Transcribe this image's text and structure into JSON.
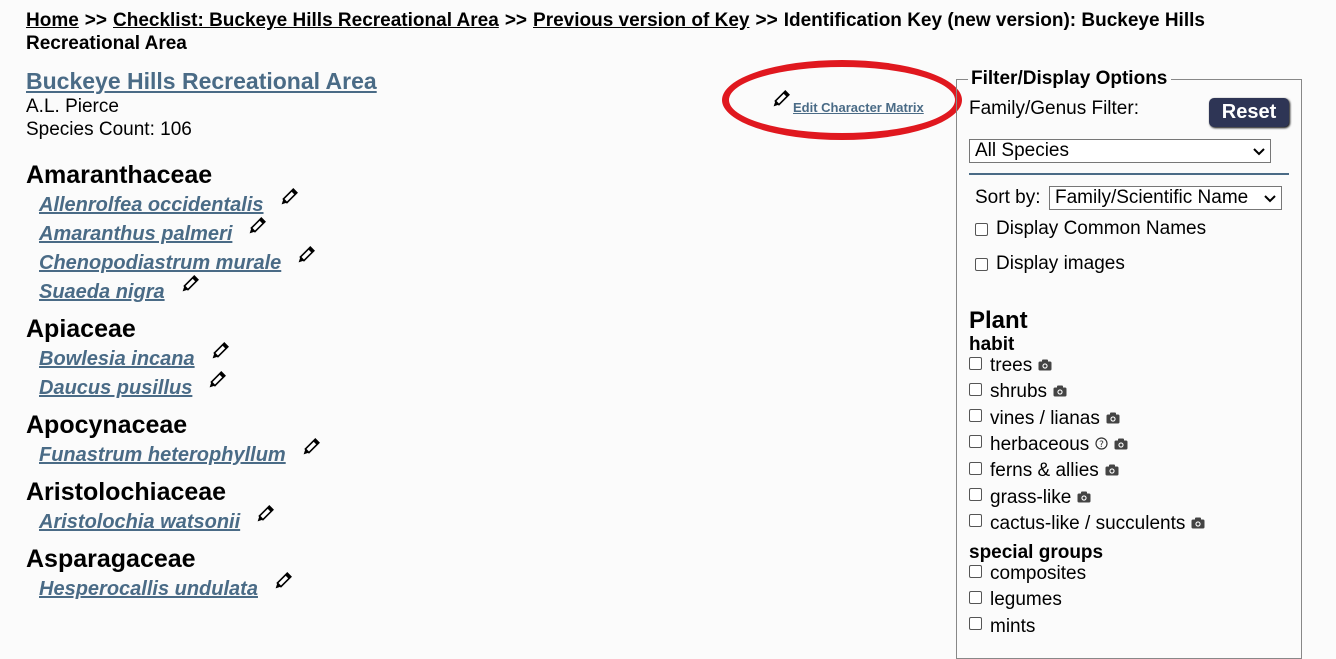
{
  "breadcrumb": {
    "home": "Home",
    "sep": ">>",
    "checklist": "Checklist: Buckeye Hills Recreational Area",
    "previous": "Previous version of Key",
    "current_line1": "Identification Key (new version): Buckeye Hills",
    "current_line2": "Recreational Area"
  },
  "header": {
    "title": "Buckeye Hills Recreational Area",
    "author": "A.L. Pierce",
    "species_count": "Species Count: 106",
    "edit_matrix": "Edit Character Matrix"
  },
  "taxa": [
    {
      "family": "Amaranthaceae",
      "species": [
        "Allenrolfea occidentalis",
        "Amaranthus palmeri",
        "Chenopodiastrum murale",
        "Suaeda nigra"
      ]
    },
    {
      "family": "Apiaceae",
      "species": [
        "Bowlesia incana",
        "Daucus pusillus"
      ]
    },
    {
      "family": "Apocynaceae",
      "species": [
        "Funastrum heterophyllum"
      ]
    },
    {
      "family": "Aristolochiaceae",
      "species": [
        "Aristolochia watsonii"
      ]
    },
    {
      "family": "Asparagaceae",
      "species": [
        "Hesperocallis undulata"
      ]
    }
  ],
  "panel": {
    "legend": "Filter/Display Options",
    "family_filter_label": "Family/Genus Filter:",
    "reset": "Reset",
    "species_select": "All Species",
    "sort_label": "Sort by:",
    "sort_select": "Family/Scientific Name",
    "display_common": "Display Common Names",
    "display_images": "Display images",
    "plant_heading": "Plant",
    "habit_heading": "habit",
    "habit": [
      {
        "label": "trees",
        "cam": true,
        "help": false
      },
      {
        "label": "shrubs",
        "cam": true,
        "help": false
      },
      {
        "label": "vines / lianas",
        "cam": true,
        "help": false
      },
      {
        "label": "herbaceous",
        "cam": true,
        "help": true
      },
      {
        "label": "ferns & allies",
        "cam": true,
        "help": false
      },
      {
        "label": "grass-like",
        "cam": true,
        "help": false
      },
      {
        "label": "cactus-like / succulents",
        "cam": true,
        "help": false
      }
    ],
    "special_heading": "special groups",
    "special": [
      {
        "label": "composites"
      },
      {
        "label": "legumes"
      },
      {
        "label": "mints"
      }
    ]
  },
  "colors": {
    "link": "#4a6b86",
    "reset_bg": "#2e3555",
    "highlight": "#e0181f"
  }
}
